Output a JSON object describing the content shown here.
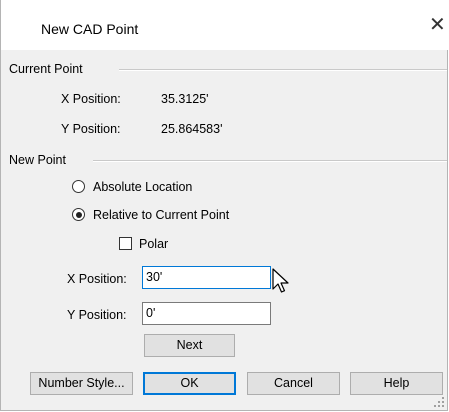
{
  "window": {
    "title": "New CAD Point",
    "close_glyph": "✕"
  },
  "current_point": {
    "section_label": "Current Point",
    "x_label": "X Position:",
    "x_value": "35.3125'",
    "y_label": "Y Position:",
    "y_value": "25.864583'"
  },
  "new_point": {
    "section_label": "New Point",
    "options": [
      {
        "label": "Absolute Location",
        "checked": false
      },
      {
        "label": "Relative to Current Point",
        "checked": true
      }
    ],
    "polar": {
      "label": "Polar",
      "checked": false
    },
    "x_label": "X Position:",
    "x_value": "30'",
    "y_label": "Y Position:",
    "y_value": "0'",
    "next_label": "Next"
  },
  "buttons": {
    "number_style": "Number Style...",
    "ok": "OK",
    "cancel": "Cancel",
    "help": "Help"
  },
  "icons": {
    "close": "close-icon",
    "cursor": "mouse-pointer-icon",
    "grip": "resize-grip-icon"
  },
  "colors": {
    "focus_accent": "#0078d7",
    "dialog_bg": "#f0f0f0"
  }
}
